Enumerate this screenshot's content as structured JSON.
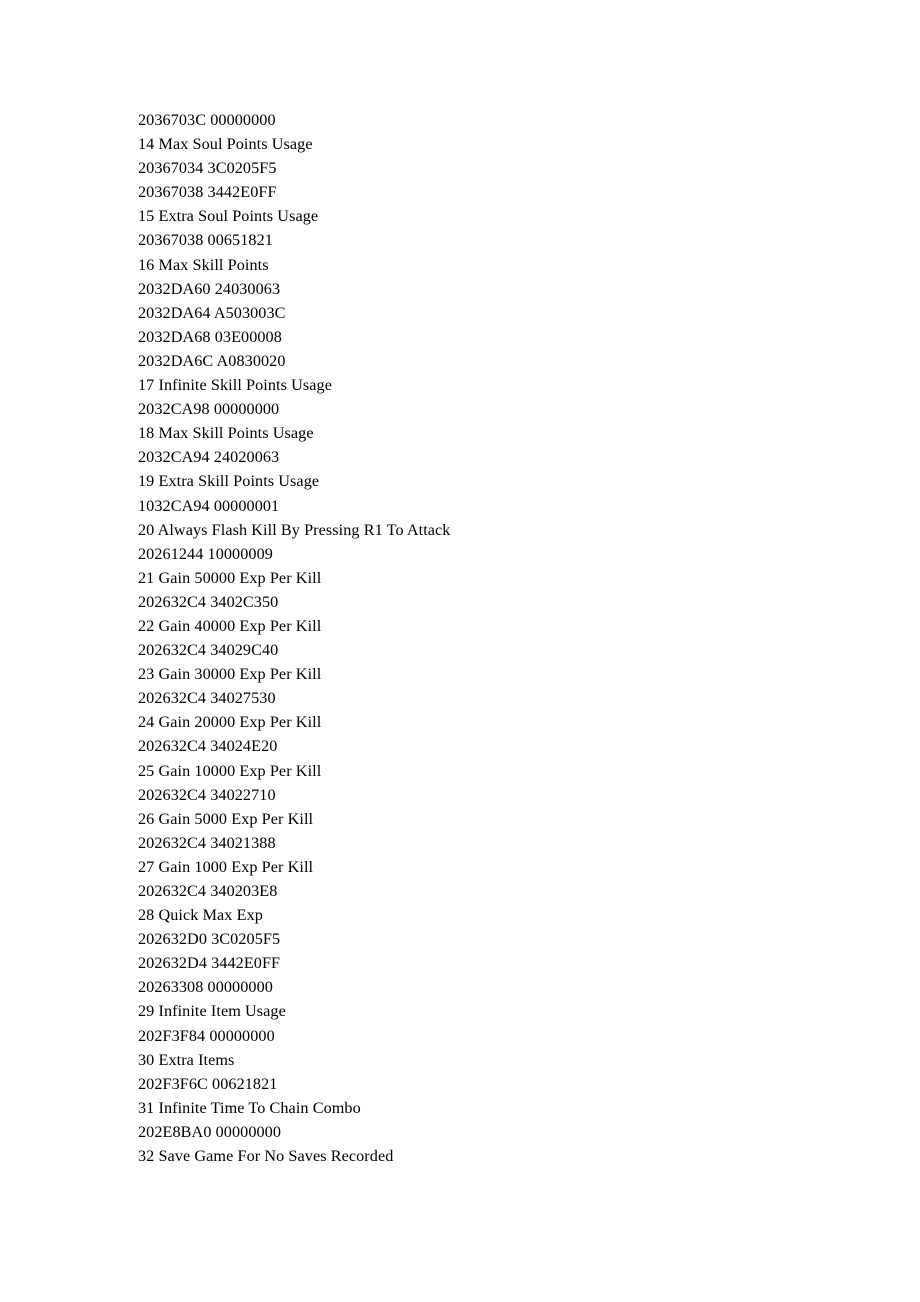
{
  "document": {
    "kind": "plain-text-page",
    "background_color": "#ffffff",
    "text_color": "#000000",
    "lines": [
      {
        "type": "code",
        "text": "2036703C 00000000"
      },
      {
        "type": "entry",
        "text": "14 Max Soul Points Usage"
      },
      {
        "type": "code",
        "text": "20367034 3C0205F5"
      },
      {
        "type": "code",
        "text": "20367038 3442E0FF"
      },
      {
        "type": "entry",
        "text": "15 Extra Soul Points Usage"
      },
      {
        "type": "code",
        "text": "20367038 00651821"
      },
      {
        "type": "entry",
        "text": "16 Max Skill Points"
      },
      {
        "type": "code",
        "text": "2032DA60 24030063"
      },
      {
        "type": "code",
        "text": "2032DA64 A503003C"
      },
      {
        "type": "code",
        "text": "2032DA68 03E00008"
      },
      {
        "type": "code",
        "text": "2032DA6C A0830020"
      },
      {
        "type": "entry",
        "text": "17 Infinite Skill Points Usage"
      },
      {
        "type": "code",
        "text": "2032CA98 00000000"
      },
      {
        "type": "entry",
        "text": "18 Max Skill Points Usage"
      },
      {
        "type": "code",
        "text": "2032CA94 24020063"
      },
      {
        "type": "entry",
        "text": "19 Extra Skill Points Usage"
      },
      {
        "type": "code",
        "text": "1032CA94 00000001"
      },
      {
        "type": "entry",
        "text": "20 Always Flash Kill By Pressing R1 To Attack"
      },
      {
        "type": "code",
        "text": "20261244 10000009"
      },
      {
        "type": "entry",
        "text": "21 Gain 50000 Exp Per Kill"
      },
      {
        "type": "code",
        "text": "202632C4 3402C350"
      },
      {
        "type": "entry",
        "text": "22 Gain 40000 Exp Per Kill"
      },
      {
        "type": "code",
        "text": "202632C4 34029C40"
      },
      {
        "type": "entry",
        "text": "23 Gain 30000 Exp Per Kill"
      },
      {
        "type": "code",
        "text": "202632C4 34027530"
      },
      {
        "type": "entry",
        "text": "24 Gain 20000 Exp Per Kill"
      },
      {
        "type": "code",
        "text": "202632C4 34024E20"
      },
      {
        "type": "entry",
        "text": "25 Gain 10000 Exp Per Kill"
      },
      {
        "type": "code",
        "text": "202632C4 34022710"
      },
      {
        "type": "entry",
        "text": "26 Gain 5000 Exp Per Kill"
      },
      {
        "type": "code",
        "text": "202632C4 34021388"
      },
      {
        "type": "entry",
        "text": "27 Gain 1000 Exp Per Kill"
      },
      {
        "type": "code",
        "text": "202632C4 340203E8"
      },
      {
        "type": "entry",
        "text": "28 Quick Max Exp"
      },
      {
        "type": "code",
        "text": "202632D0 3C0205F5"
      },
      {
        "type": "code",
        "text": "202632D4 3442E0FF"
      },
      {
        "type": "code",
        "text": "20263308 00000000"
      },
      {
        "type": "entry",
        "text": "29 Infinite Item Usage"
      },
      {
        "type": "code",
        "text": "202F3F84 00000000"
      },
      {
        "type": "entry",
        "text": "30 Extra Items"
      },
      {
        "type": "code",
        "text": "202F3F6C 00621821"
      },
      {
        "type": "entry",
        "text": "31 Infinite Time To Chain Combo"
      },
      {
        "type": "code",
        "text": "202E8BA0 00000000"
      },
      {
        "type": "entry",
        "text": "32 Save Game For No Saves Recorded"
      }
    ]
  }
}
